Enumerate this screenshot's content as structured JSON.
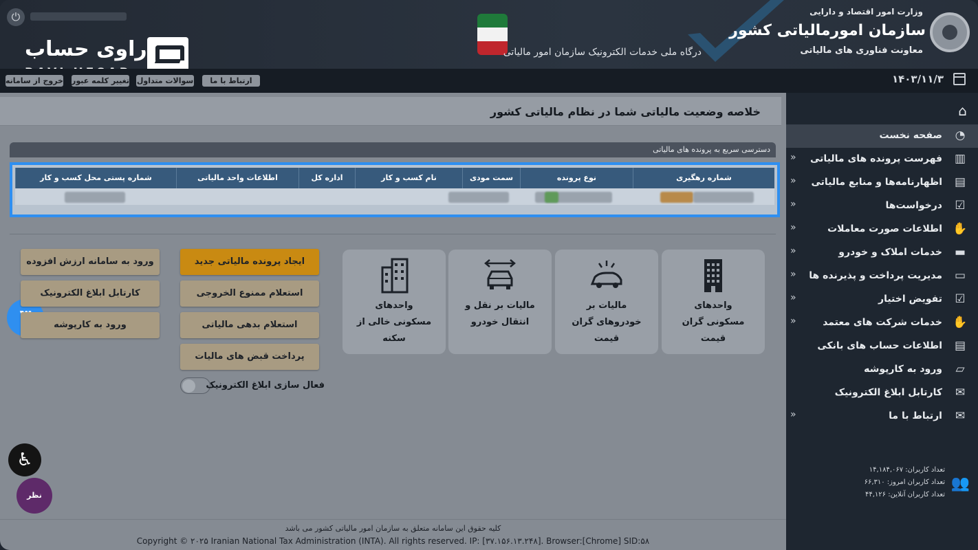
{
  "header": {
    "portal_title": "درگاه ملی خدمات الکترونیک سازمان امور مالیاتی",
    "org_top": "وزارت امور اقتصاد و دارایی",
    "org_main": "سازمان امورمالیاتی کشور",
    "org_sub": "معاونت فناوری های مالیاتی",
    "watermark_fa": "راوی حساب",
    "watermark_en": "RAVI HESAB"
  },
  "topnav": {
    "contact": "ارتباط با ما",
    "faq": "سوالات متداول",
    "change_password": "تغییر کلمه عبور",
    "logout": "خروج از سامانه",
    "date": "۱۴۰۳/۱۱/۳"
  },
  "sidebar": {
    "items": [
      {
        "label": "صفحه نخست",
        "icon": "dashboard-icon",
        "chevron": false
      },
      {
        "label": "فهرست پرونده های مالیاتی",
        "icon": "files-icon",
        "chevron": true
      },
      {
        "label": "اظهارنامه‌ها و منابع مالیاتی",
        "icon": "document-icon",
        "chevron": true
      },
      {
        "label": "درخواست‌ها",
        "icon": "request-icon",
        "chevron": true
      },
      {
        "label": "اطلاعات صورت معاملات",
        "icon": "handshake-icon",
        "chevron": true
      },
      {
        "label": "خدمات املاک و خودرو",
        "icon": "car-icon",
        "chevron": true
      },
      {
        "label": "مدیریت پرداخت و پذیرنده ها",
        "icon": "card-icon",
        "chevron": true
      },
      {
        "label": "تفویض اختیار",
        "icon": "delegation-icon",
        "chevron": true
      },
      {
        "label": "خدمات شرکت های معتمد",
        "icon": "trust-icon",
        "chevron": true
      },
      {
        "label": "اطلاعات حساب های بانکی",
        "icon": "bank-icon",
        "chevron": false
      },
      {
        "label": "ورود به کارپوشه",
        "icon": "folder-icon",
        "chevron": false
      },
      {
        "label": "کارتابل ابلاغ الکترونیک",
        "icon": "mail-icon",
        "chevron": false
      },
      {
        "label": "ارتباط با ما",
        "icon": "envelope-icon",
        "chevron": true
      }
    ],
    "stats": {
      "total_users": "تعداد کاربران: ۱۴,۱۸۴,۰۶۷",
      "today_users": "تعداد کاربران امروز: ۶۶,۳۱۰",
      "online_users": "تعداد کاربران آنلاین: ۴۴,۱۲۶"
    }
  },
  "main": {
    "page_title": "خلاصه وضعیت مالیاتی شما در نظام مالیاتی کشور",
    "quick_access_title": "دسترسی سریع به پرونده های مالیاتی",
    "table_headers": [
      "شماره رهگیری",
      "نوع پرونده",
      "سمت مودی",
      "نام کسب و کار",
      "اداره کل",
      "اطلاعات واحد مالیاتی",
      "شماره پستی محل کسب و کار"
    ],
    "step_badge": "۳",
    "cards": [
      {
        "line1": "واحدهای",
        "line2": "مسکونی گران",
        "line3": "قیمت"
      },
      {
        "line1": "مالیات بر",
        "line2": "خودروهای گران",
        "line3": "قیمت"
      },
      {
        "line1": "مالیات بر نقل و",
        "line2": "انتقال خودرو",
        "line3": ""
      },
      {
        "line1": "واحدهای",
        "line2": "مسکونی خالی از",
        "line3": "سکنه"
      }
    ],
    "buttons_mid": [
      "ایجاد پرونده مالیاتی جدید",
      "استعلام ممنوع الخروجی",
      "استعلام بدهی مالیاتی",
      "پرداخت قبض های مالیات"
    ],
    "buttons_left": [
      "ورود به سامانه ارزش افزوده",
      "کارتابل ابلاغ الکترونیک",
      "ورود به کارپوشه"
    ],
    "toggle_label": "فعال سازی ابلاغ الکترونیک",
    "accessibility_label": "♿",
    "survey_label": "نظر سنجی"
  },
  "footer": {
    "rights_fa": "کلیه حقوق این سامانه متعلق به سازمان امور مالیاتی کشور می باشد",
    "copyright": "Copyright © ۲۰۲۵ Iranian National Tax Administration (INTA). All rights reserved. IP: [۳۷.۱۵۶.۱۳.۲۴۸]. Browser:[Chrome] SID:۵۸"
  },
  "colors": {
    "highlight_blue": "#2f8ff0",
    "orange_button": "#c98a12",
    "tan_button": "#a89b82",
    "sidebar_bg": "#1e2630"
  }
}
